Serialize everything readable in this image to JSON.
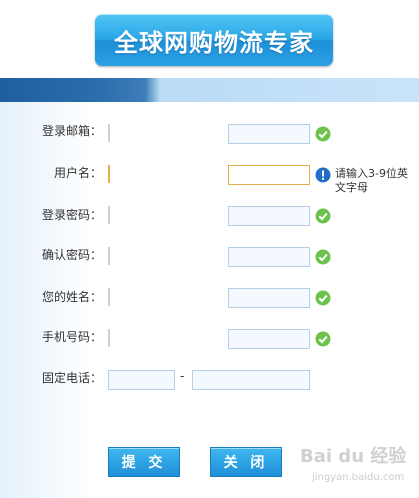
{
  "banner": {
    "title": "全球网购物流专家"
  },
  "form": {
    "email_label": "登录邮箱：",
    "username_label": "用户名：",
    "password_label": "登录密码：",
    "confirm_label": "确认密码：",
    "name_label": "您的姓名：",
    "mobile_label": "手机号码：",
    "phone_label": "固定电话：",
    "phone_separator": "-",
    "username_hint": "请输入3-9位英文字母",
    "email_value": "",
    "username_value": "",
    "password_value": "",
    "confirm_value": "",
    "name_value": "",
    "mobile_value": "",
    "phone_area_value": "",
    "phone_number_value": ""
  },
  "buttons": {
    "submit_label": "提 交",
    "close_label": "关 闭"
  },
  "watermark": {
    "brand": "Bai du 经验",
    "url": "jingyan.baidu.com"
  },
  "colors": {
    "accent": "#2aa6e6",
    "valid": "#6cc24a",
    "info": "#1f6fc7",
    "active_border": "#e2b24a"
  },
  "icons": {
    "valid": "check-circle-icon",
    "info": "info-circle-icon"
  }
}
